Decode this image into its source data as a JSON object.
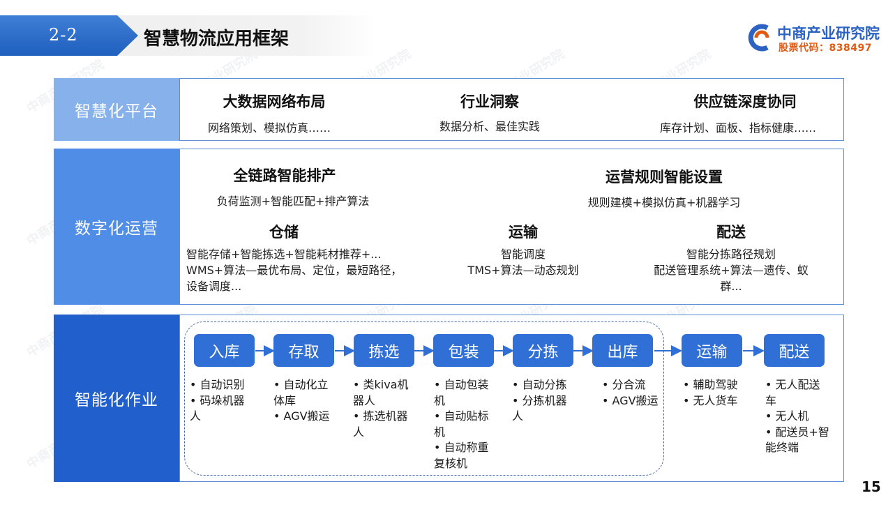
{
  "header": {
    "section_number": "2-2",
    "title": "智慧物流应用框架"
  },
  "logo": {
    "name": "中商产业研究院",
    "stock_code": "股票代码：838497"
  },
  "watermark": "中商产业研究院",
  "rows": {
    "platform": {
      "label": "智慧化平台",
      "items": [
        {
          "title": "大数据网络布局",
          "desc": "网络策划、模拟仿真……"
        },
        {
          "title": "行业洞察",
          "desc": "数据分析、最佳实践"
        },
        {
          "title": "供应链深度协同",
          "desc": "库存计划、面板、指标健康……"
        }
      ]
    },
    "operations": {
      "label": "数字化运营",
      "top": [
        {
          "title": "全链路智能排产",
          "desc": "负荷监测+智能匹配+排产算法"
        },
        {
          "title": "运营规则智能设置",
          "desc": "规则建模+模拟仿真+机器学习"
        }
      ],
      "bottom": [
        {
          "title": "仓储",
          "desc": "智能存储+智能拣选+智能耗材推荐+...\nWMS+算法—最优布局、定位，最短路径，\n设备调度..."
        },
        {
          "title": "运输",
          "desc": "智能调度\nTMS+算法—动态规划"
        },
        {
          "title": "配送",
          "desc": "智能分拣路径规划\n配送管理系统+算法—遗传、蚁\n群..."
        }
      ]
    },
    "execution": {
      "label": "智能化作业",
      "steps": [
        {
          "name": "入库",
          "bullets": "• 自动识别\n• 码垛机器\n  人"
        },
        {
          "name": "存取",
          "bullets": "• 自动化立\n  体库\n• AGV搬运"
        },
        {
          "name": "拣选",
          "bullets": "• 类kiva机\n  器人\n• 拣选机器\n  人"
        },
        {
          "name": "包装",
          "bullets": "• 自动包装\n  机\n• 自动贴标\n  机\n• 自动称重\n  复核机"
        },
        {
          "name": "分拣",
          "bullets": "• 自动分拣\n• 分拣机器\n  人"
        },
        {
          "name": "出库",
          "bullets": "• 分合流\n• AGV搬运"
        },
        {
          "name": "运输",
          "bullets": "• 辅助驾驶\n• 无人货车"
        },
        {
          "name": "配送",
          "bullets": "• 无人配送\n  车\n• 无人机\n• 配送员+智\n  能终端"
        }
      ]
    }
  },
  "page_number": "15",
  "colors": {
    "header_blue": "#2f6fd6",
    "platform_label": "#86b1ea",
    "operations_label": "#4f8de6",
    "execution_label": "#2160cc",
    "step_box": "#2f6fd6",
    "logo_orange": "#e05a14"
  }
}
